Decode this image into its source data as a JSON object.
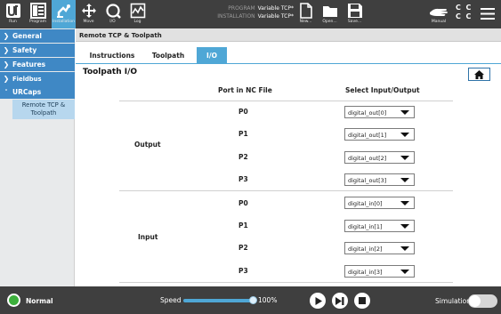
{
  "topbar": {
    "buttons": [
      {
        "label": "Run",
        "icon": "ur-logo-icon"
      },
      {
        "label": "Program",
        "icon": "program-icon"
      },
      {
        "label": "Installation",
        "icon": "installation-icon"
      },
      {
        "label": "Move",
        "icon": "move-icon"
      },
      {
        "label": "I/O",
        "icon": "io-icon"
      },
      {
        "label": "Log",
        "icon": "log-icon"
      },
      {
        "label": "New...",
        "icon": "new-file-icon"
      },
      {
        "label": "Open...",
        "icon": "open-folder-icon"
      },
      {
        "label": "Save...",
        "icon": "save-icon"
      },
      {
        "label": "Manual",
        "icon": "manual-hand-icon"
      }
    ],
    "program_key": "PROGRAM",
    "program_value": "Variable TCP*",
    "installation_key": "INSTALLATION",
    "installation_value": "Variable TCP*",
    "cc": [
      "C",
      "C",
      "C",
      "C"
    ],
    "accent": "#4fa7d6"
  },
  "sidebar": {
    "items": [
      {
        "label": "General"
      },
      {
        "label": "Safety"
      },
      {
        "label": "Features"
      },
      {
        "label": "Fieldbus"
      },
      {
        "label": "URCaps"
      }
    ],
    "sub_item": "Remote TCP & Toolpath"
  },
  "main": {
    "breadcrumb": "Remote TCP & Toolpath",
    "tabs": [
      "Instructions",
      "Toolpath",
      "I/O"
    ],
    "active_tab": "I/O",
    "title": "Toolpath I/O",
    "col_port": "Port in NC File",
    "col_select": "Select Input/Output",
    "groups": [
      {
        "name": "Output",
        "rows": [
          {
            "port": "P0",
            "value": "digital_out[0]"
          },
          {
            "port": "P1",
            "value": "digital_out[1]"
          },
          {
            "port": "P2",
            "value": "digital_out[2]"
          },
          {
            "port": "P3",
            "value": "digital_out[3]"
          }
        ]
      },
      {
        "name": "Input",
        "rows": [
          {
            "port": "P0",
            "value": "digital_in[0]"
          },
          {
            "port": "P1",
            "value": "digital_in[1]"
          },
          {
            "port": "P2",
            "value": "digital_in[2]"
          },
          {
            "port": "P3",
            "value": "digital_in[3]"
          }
        ]
      }
    ]
  },
  "footer": {
    "status": "Normal",
    "speed_label": "Speed",
    "speed_value": "100%",
    "speed_fraction": 1.0,
    "simulation_label": "Simulation",
    "simulation_on": false
  }
}
